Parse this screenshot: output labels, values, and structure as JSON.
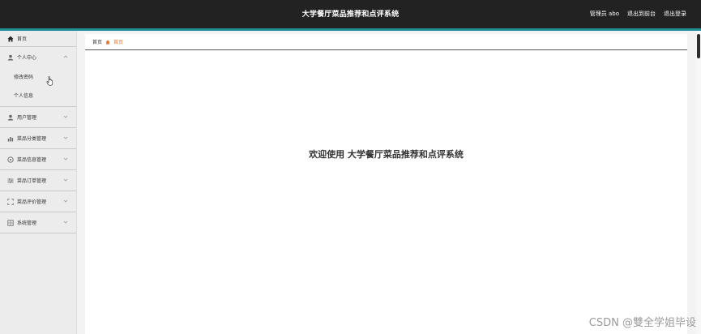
{
  "header": {
    "title": "大学餐厅菜品推荐和点评系统",
    "admin_label": "管理员 abo",
    "back_to_front": "退出到前台",
    "logout": "退出登录"
  },
  "sidebar": {
    "home": "首页",
    "items": [
      {
        "label": "个人中心",
        "icon": "user-icon",
        "expanded": true,
        "children": [
          "修改密码",
          "个人信息"
        ]
      },
      {
        "label": "用户管理",
        "icon": "user-icon"
      },
      {
        "label": "菜品分类管理",
        "icon": "bar-chart-icon"
      },
      {
        "label": "菜品信息管理",
        "icon": "circle-icon"
      },
      {
        "label": "菜品订单管理",
        "icon": "sliders-icon"
      },
      {
        "label": "菜品评价管理",
        "icon": "frame-icon"
      },
      {
        "label": "系统管理",
        "icon": "grid-icon"
      }
    ]
  },
  "breadcrumb": {
    "home": "首页",
    "current": "首页"
  },
  "main": {
    "welcome": "欢迎使用 大学餐厅菜品推荐和点评系统"
  },
  "watermark": "CSDN @雙全学姐毕设",
  "colors": {
    "topbar": "#222222",
    "accent": "#1f8f9a",
    "breadcrumb_current": "#e07b39"
  }
}
